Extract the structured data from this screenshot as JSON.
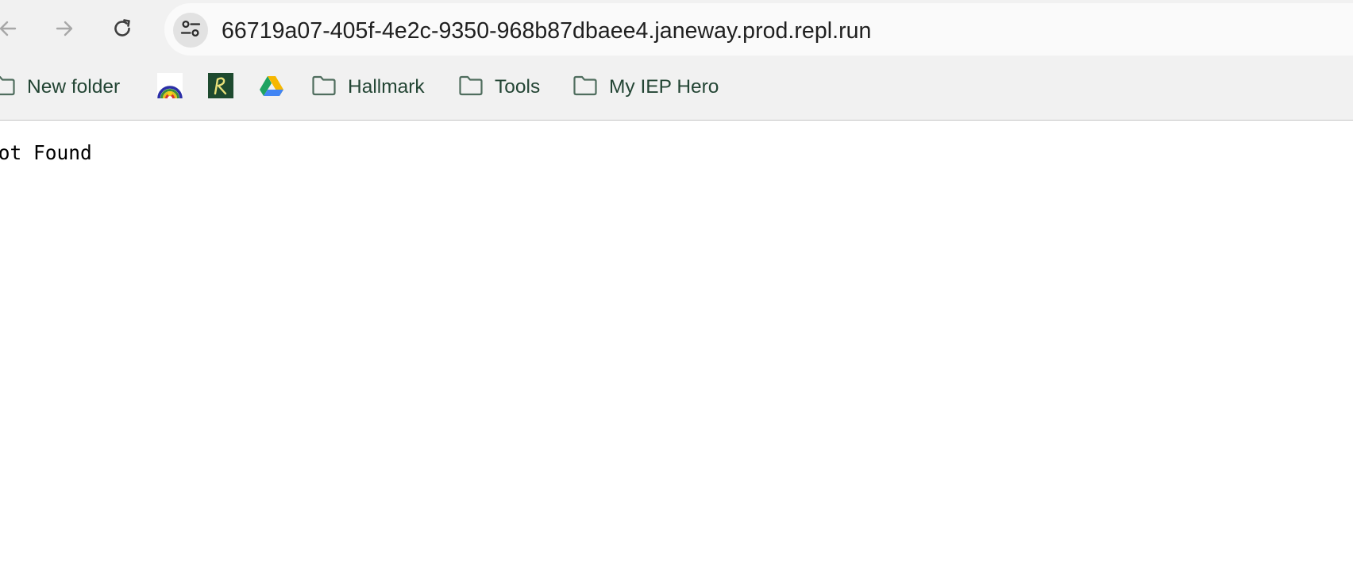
{
  "toolbar": {
    "back_icon": "arrow-left-icon",
    "forward_icon": "arrow-right-icon",
    "reload_icon": "reload-icon"
  },
  "omnibox": {
    "site_info_icon": "tune-icon",
    "url": "66719a07-405f-4e2c-9350-968b87dbaee4.janeway.prod.repl.run"
  },
  "bookmarks": {
    "items": [
      {
        "label": "New folder",
        "icon": "folder-icon"
      },
      {
        "label": "",
        "icon": "rainbow-favicon"
      },
      {
        "label": "",
        "icon": "r-letter-favicon"
      },
      {
        "label": "",
        "icon": "google-drive-icon"
      },
      {
        "label": "Hallmark",
        "icon": "folder-icon"
      },
      {
        "label": "Tools",
        "icon": "folder-icon"
      },
      {
        "label": "My IEP Hero",
        "icon": "folder-icon"
      }
    ]
  },
  "page": {
    "body_text": "Not Found"
  },
  "colors": {
    "chrome_bg": "#f1f1f1",
    "omnibox_bg": "#fafafa",
    "bookmark_text": "#234534",
    "folder_stroke": "#4f6d5e"
  }
}
